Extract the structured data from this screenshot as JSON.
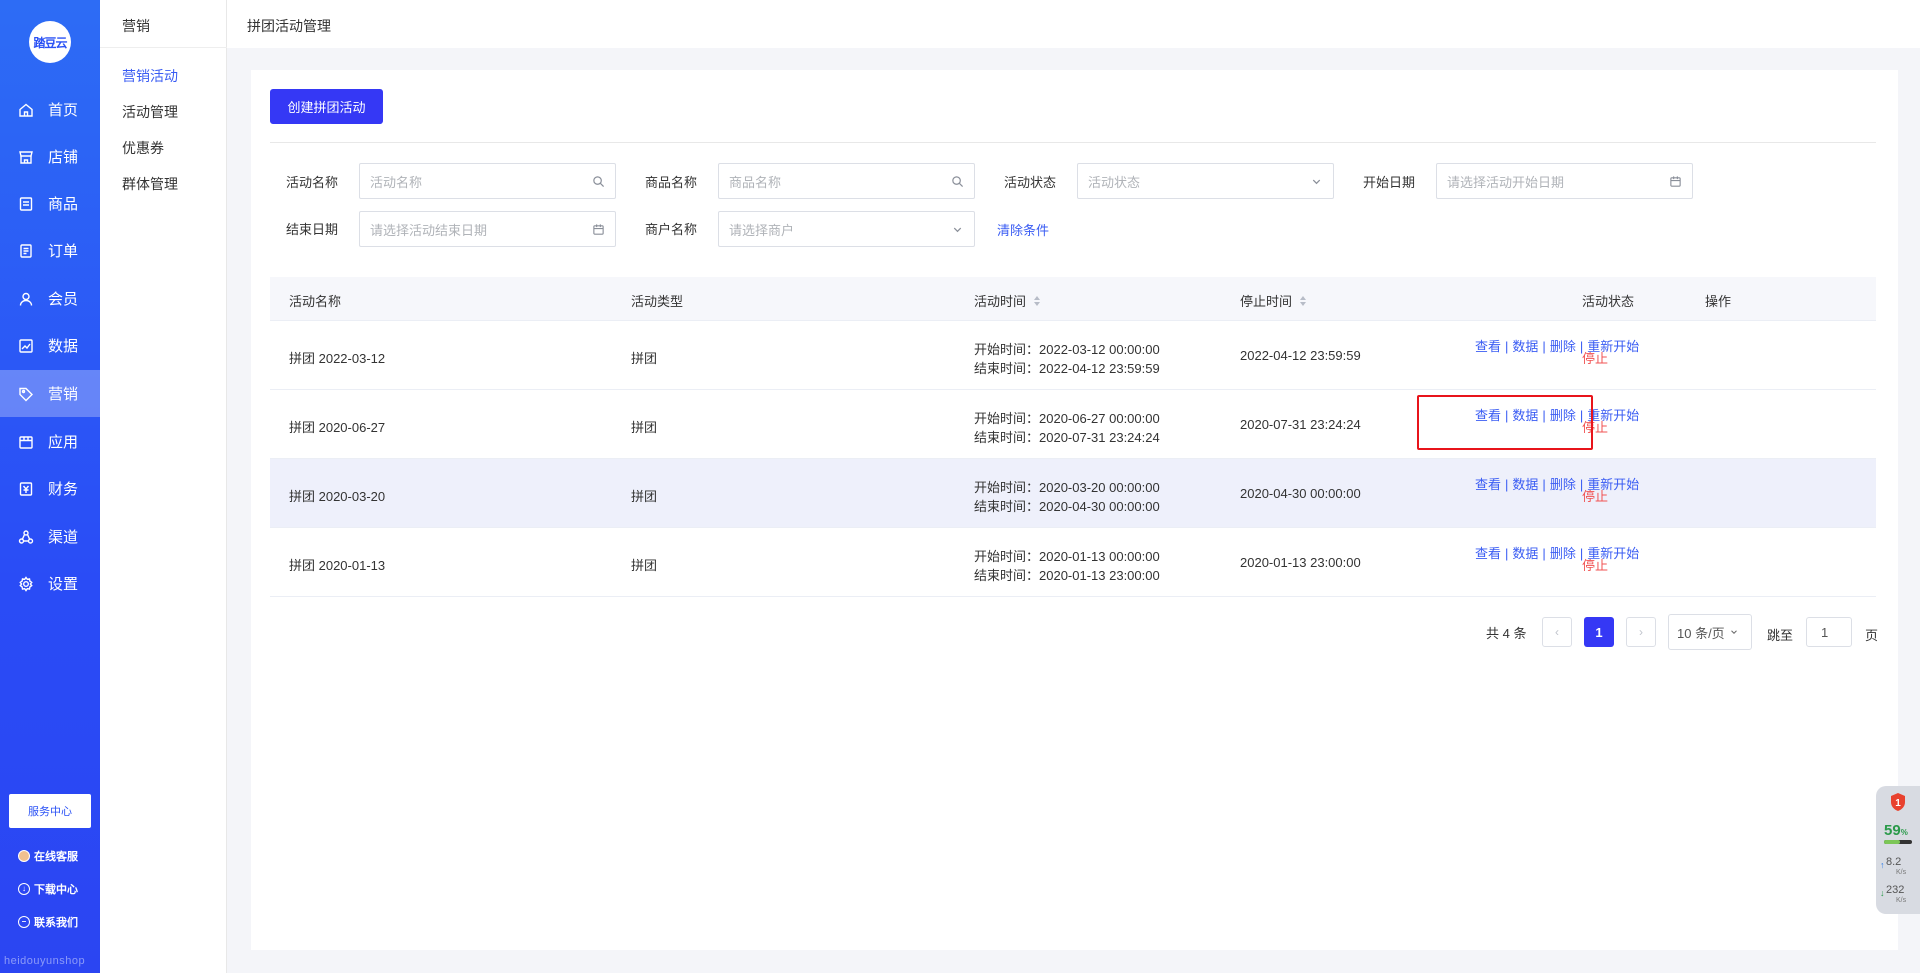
{
  "brand": {
    "logo_text": "踏豆云",
    "watermark": "heidouyunshop"
  },
  "nav": {
    "items": [
      {
        "label": "首页",
        "icon": "home-icon"
      },
      {
        "label": "店铺",
        "icon": "store-icon"
      },
      {
        "label": "商品",
        "icon": "goods-icon"
      },
      {
        "label": "订单",
        "icon": "order-icon"
      },
      {
        "label": "会员",
        "icon": "member-icon"
      },
      {
        "label": "数据",
        "icon": "chart-icon"
      },
      {
        "label": "营销",
        "icon": "tag-icon",
        "active": true
      },
      {
        "label": "应用",
        "icon": "app-icon"
      },
      {
        "label": "财务",
        "icon": "finance-icon"
      },
      {
        "label": "渠道",
        "icon": "channel-icon"
      },
      {
        "label": "设置",
        "icon": "gear-icon"
      }
    ],
    "service_center": "服务中心",
    "links": [
      "在线客服",
      "下载中心",
      "联系我们"
    ]
  },
  "subnav": {
    "title": "营销",
    "items": [
      "营销活动",
      "活动管理",
      "优惠券",
      "群体管理"
    ],
    "active_index": 0
  },
  "header": {
    "title": "拼团活动管理"
  },
  "toolbar": {
    "create_label": "创建拼团活动"
  },
  "filters": {
    "activity_name": {
      "label": "活动名称",
      "placeholder": "活动名称"
    },
    "goods_name": {
      "label": "商品名称",
      "placeholder": "商品名称"
    },
    "status": {
      "label": "活动状态",
      "placeholder": "活动状态"
    },
    "start_date": {
      "label": "开始日期",
      "placeholder": "请选择活动开始日期"
    },
    "end_date": {
      "label": "结束日期",
      "placeholder": "请选择活动结束日期"
    },
    "merchant": {
      "label": "商户名称",
      "placeholder": "请选择商户"
    },
    "clear_label": "清除条件"
  },
  "table": {
    "columns": [
      "活动名称",
      "活动类型",
      "活动时间",
      "停止时间",
      "活动状态",
      "操作"
    ],
    "rows": [
      {
        "name": "拼团 2022-03-12",
        "type": "拼团",
        "start": "开始时间：2022-03-12 00:00:00",
        "end": "结束时间：2022-04-12 23:59:59",
        "stop": "2022-04-12 23:59:59",
        "status": "停止"
      },
      {
        "name": "拼团 2020-06-27",
        "type": "拼团",
        "start": "开始时间：2020-06-27 00:00:00",
        "end": "结束时间：2020-07-31 23:24:24",
        "stop": "2020-07-31 23:24:24",
        "status": "停止"
      },
      {
        "name": "拼团 2020-03-20",
        "type": "拼团",
        "start": "开始时间：2020-03-20 00:00:00",
        "end": "结束时间：2020-04-30 00:00:00",
        "stop": "2020-04-30 00:00:00",
        "status": "停止"
      },
      {
        "name": "拼团 2020-01-13",
        "type": "拼团",
        "start": "开始时间：2020-01-13 00:00:00",
        "end": "结束时间：2020-01-13 23:00:00",
        "stop": "2020-01-13 23:00:00",
        "status": "停止"
      }
    ],
    "actions": [
      "查看",
      "数据",
      "删除",
      "重新开始"
    ]
  },
  "pagination": {
    "total_text": "共 4 条",
    "current_page": "1",
    "page_size": "10 条/页",
    "jump_label": "跳至",
    "jump_value": "1",
    "page_suffix": "页"
  },
  "widget": {
    "badge": "1",
    "cpu": "59",
    "cpu_unit": "%",
    "up_speed": "8.2",
    "down_speed": "232",
    "speed_unit": "K/s"
  },
  "colors": {
    "accent": "#3538f5",
    "nav_bg": "#2b52f5",
    "danger": "#f15353",
    "highlight_border": "#e8141b"
  }
}
